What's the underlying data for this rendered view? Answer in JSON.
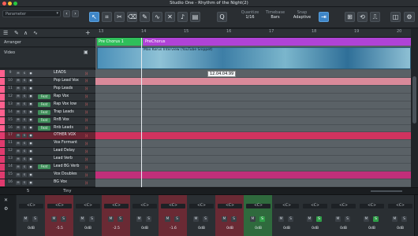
{
  "window": {
    "title": "Studio One - Rhythm of the Night(2)",
    "parameter_label": "Parameter"
  },
  "toolbar": {
    "quantize_label": "Quantize",
    "quantize_value": "1/16",
    "timebase_label": "Timebase",
    "timebase_value": "Bars",
    "snap_label": "Snap",
    "snap_value": "Adaptive"
  },
  "ruler": {
    "bars": [
      "13",
      "14",
      "15",
      "16",
      "17",
      "18",
      "19",
      "20"
    ]
  },
  "arranger": {
    "label": "Arranger",
    "sections": [
      {
        "name": "Pre Chorus 1",
        "color": "#2fbf5a"
      },
      {
        "name": "PreChorus",
        "color": "#b043d6"
      }
    ]
  },
  "video": {
    "label": "Video",
    "clip_text": "Max Korus Interview (YouTube Snippet)"
  },
  "cursor_time": "12.04.04.99",
  "tracks": [
    {
      "num": "9",
      "name": "LEADS",
      "folder": true,
      "color": "#ff5f8e",
      "lane": "#5a6166",
      "feat": ""
    },
    {
      "num": "10",
      "name": "Pop Lead Vox",
      "color": "#ff5f8e",
      "lane": "#d98a9a",
      "feat": ""
    },
    {
      "num": "11",
      "name": "Pop Leads",
      "color": "#ff5f8e",
      "lane": "#5a6166",
      "feat": ""
    },
    {
      "num": "12",
      "name": "Rap Vox",
      "color": "#ff5f8e",
      "lane": "#5a6166",
      "feat": "Feat"
    },
    {
      "num": "13",
      "name": "Rap Vox low",
      "color": "#ff5f8e",
      "lane": "#5a6166",
      "feat": "Feat"
    },
    {
      "num": "14",
      "name": "Trap Leads",
      "color": "#ff5f8e",
      "lane": "#5a6166",
      "feat": "Feat"
    },
    {
      "num": "15",
      "name": "RnB Vox",
      "color": "#ff5f8e",
      "lane": "#5a6166",
      "feat": "Feat"
    },
    {
      "num": "16",
      "name": "Rnb Leads",
      "color": "#ff5f8e",
      "lane": "#5a6166",
      "feat": "Feat"
    },
    {
      "num": "17",
      "name": "OTHER VOX",
      "folder": true,
      "color": "#e03a6e",
      "lane": "#d0335f",
      "feat": ""
    },
    {
      "num": "11",
      "name": "Vox Formant",
      "color": "#e03a6e",
      "lane": "#5a6166",
      "feat": ""
    },
    {
      "num": "12",
      "name": "Lead Delay",
      "color": "#e03a6e",
      "lane": "#5a6166",
      "feat": ""
    },
    {
      "num": "13",
      "name": "Lead Verb",
      "color": "#e03a6e",
      "lane": "#5a6166",
      "feat": ""
    },
    {
      "num": "14",
      "name": "Lead BG Verb",
      "color": "#e03a6e",
      "lane": "#5a6166",
      "feat": "Feat"
    },
    {
      "num": "15",
      "name": "Vox Doubles",
      "color": "#e03a6e",
      "lane": "#c12f7a",
      "feat": ""
    },
    {
      "num": "16",
      "name": "BG Vox",
      "color": "#e03a6e",
      "lane": "#5a6166",
      "feat": ""
    }
  ],
  "bottom": {
    "left": "5",
    "mid": "Tiny"
  },
  "mixer": [
    {
      "io": "<C>",
      "vol": "0dB",
      "tone": "plain",
      "solo": false
    },
    {
      "io": "<C>",
      "vol": "-5.5",
      "tone": "red",
      "solo": false
    },
    {
      "io": "<C>",
      "vol": "0dB",
      "tone": "plain",
      "solo": false
    },
    {
      "io": "<C>",
      "vol": "-2.5",
      "tone": "red",
      "solo": false
    },
    {
      "io": "<C>",
      "vol": "0dB",
      "tone": "plain",
      "solo": false
    },
    {
      "io": "<C>",
      "vol": "-1.6",
      "tone": "red",
      "solo": false
    },
    {
      "io": "<C>",
      "vol": "0dB",
      "tone": "plain",
      "solo": false
    },
    {
      "io": "<C>",
      "vol": "0dB",
      "tone": "red",
      "solo": false
    },
    {
      "io": "<C>",
      "vol": "0dB",
      "tone": "green",
      "solo": true
    },
    {
      "io": "<C>",
      "vol": "0dB",
      "tone": "plain",
      "solo": false
    },
    {
      "io": "<C>",
      "vol": "0dB",
      "tone": "plain",
      "solo": true
    },
    {
      "io": "<C>",
      "vol": "0dB",
      "tone": "plain",
      "solo": false
    },
    {
      "io": "<C>",
      "vol": "0dB",
      "tone": "plain",
      "solo": true
    },
    {
      "io": "<C>",
      "vol": "0dB",
      "tone": "plain",
      "solo": false
    }
  ]
}
